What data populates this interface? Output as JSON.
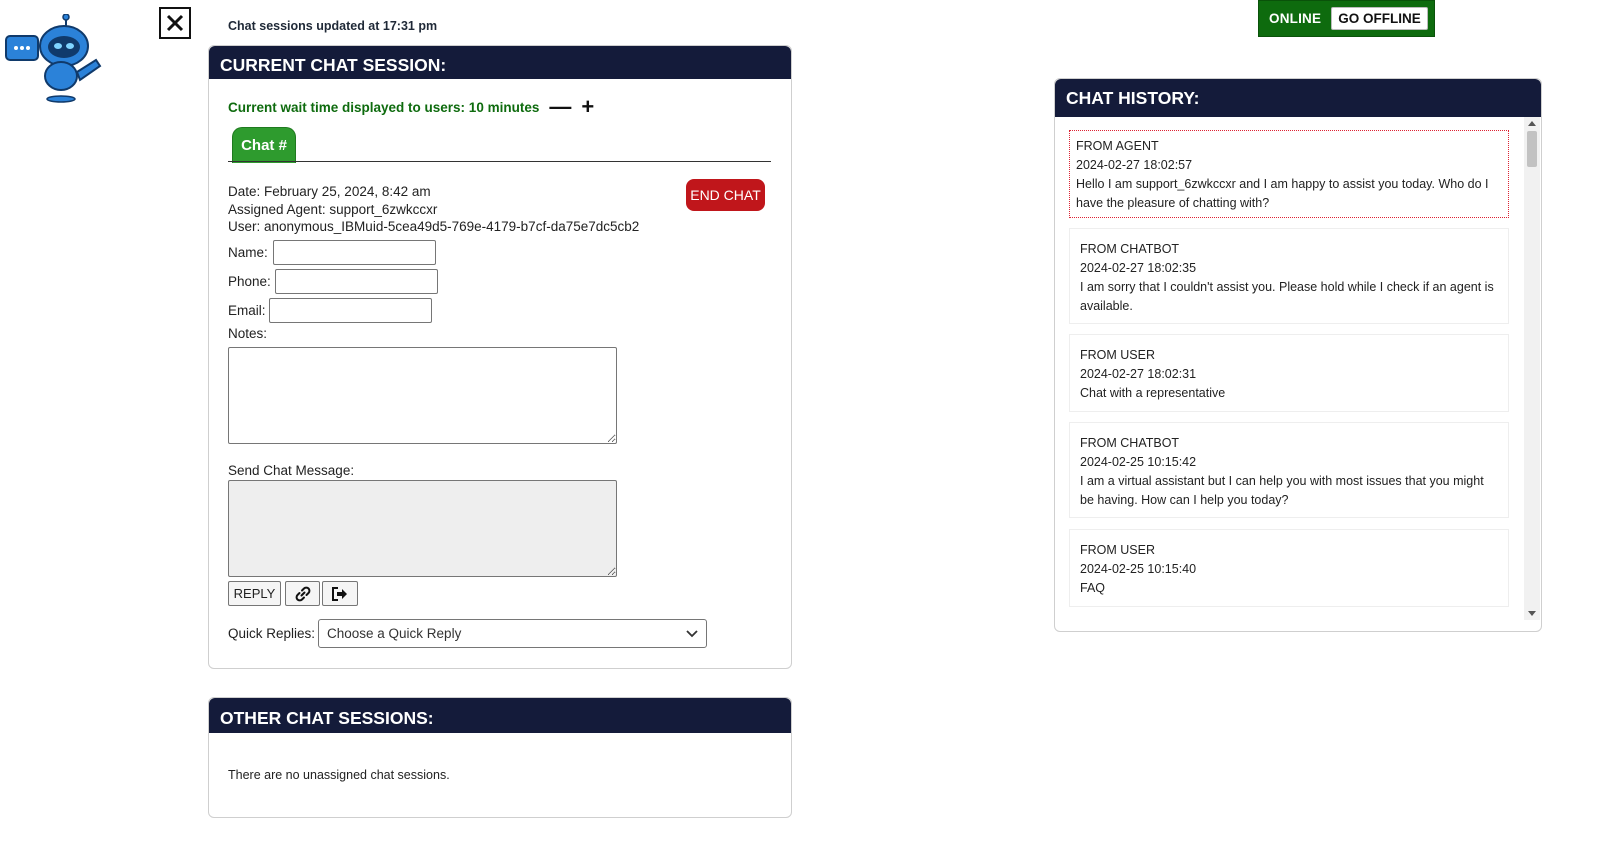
{
  "top": {
    "updated_text": "Chat sessions updated at 17:31 pm",
    "close_icon": "x-icon",
    "logo_icon": "robot-chatbot-logo"
  },
  "status": {
    "label": "ONLINE",
    "toggle_label": "GO OFFLINE",
    "color": "#0e6b0e"
  },
  "current_session": {
    "title": "CURRENT CHAT SESSION:",
    "wait_text": "Current wait time displayed to users: 10 minutes",
    "decrease_label": "—",
    "increase_label": "+",
    "tab_label": "Chat #",
    "date_line": "Date: February 25, 2024, 8:42 am",
    "agent_line": "Assigned Agent: support_6zwkccxr",
    "user_line": "User: anonymous_IBMuid-5cea49d5-769e-4179-b7cf-da75e7dc5cb2",
    "end_chat_label": "END CHAT",
    "name_label": "Name:",
    "name_value": "",
    "phone_label": "Phone:",
    "phone_value": "",
    "email_label": "Email:",
    "email_value": "",
    "notes_label": "Notes:",
    "notes_value": "",
    "send_label": "Send Chat Message:",
    "send_value": "",
    "reply_label": "REPLY",
    "link_icon": "link-icon",
    "exit_icon": "sign-out-icon",
    "quick_label": "Quick Replies:",
    "quick_selected": "Choose a Quick Reply"
  },
  "other_sessions": {
    "title": "OTHER CHAT SESSIONS:",
    "empty_text": "There are no unassigned chat sessions."
  },
  "history": {
    "title": "CHAT HISTORY:",
    "messages": [
      {
        "from": "FROM AGENT",
        "time": "2024-02-27 18:02:57",
        "lines": [
          "Hello I am support_6zwkccxr and I am happy to assist you today. Who do I",
          "have the pleasure of chatting with?"
        ]
      },
      {
        "from": "FROM CHATBOT",
        "time": "2024-02-27 18:02:35",
        "lines": [
          "I am sorry that I couldn't assist you. Please hold while I check if an agent is",
          "available."
        ]
      },
      {
        "from": "FROM USER",
        "time": "2024-02-27 18:02:31",
        "lines": [
          "Chat with a representative"
        ]
      },
      {
        "from": "FROM CHATBOT",
        "time": "2024-02-25 10:15:42",
        "lines": [
          "I am a virtual assistant but I can help you with most issues that you might",
          "be having. How can I help you today?"
        ]
      },
      {
        "from": "FROM USER",
        "time": "2024-02-25 10:15:40",
        "lines": [
          "FAQ"
        ]
      }
    ]
  },
  "colors": {
    "header_bg": "#141b3a",
    "end_chat": "#c0161b",
    "tab_green": "#2e9b2e",
    "wait_green": "#0e6b0e"
  }
}
